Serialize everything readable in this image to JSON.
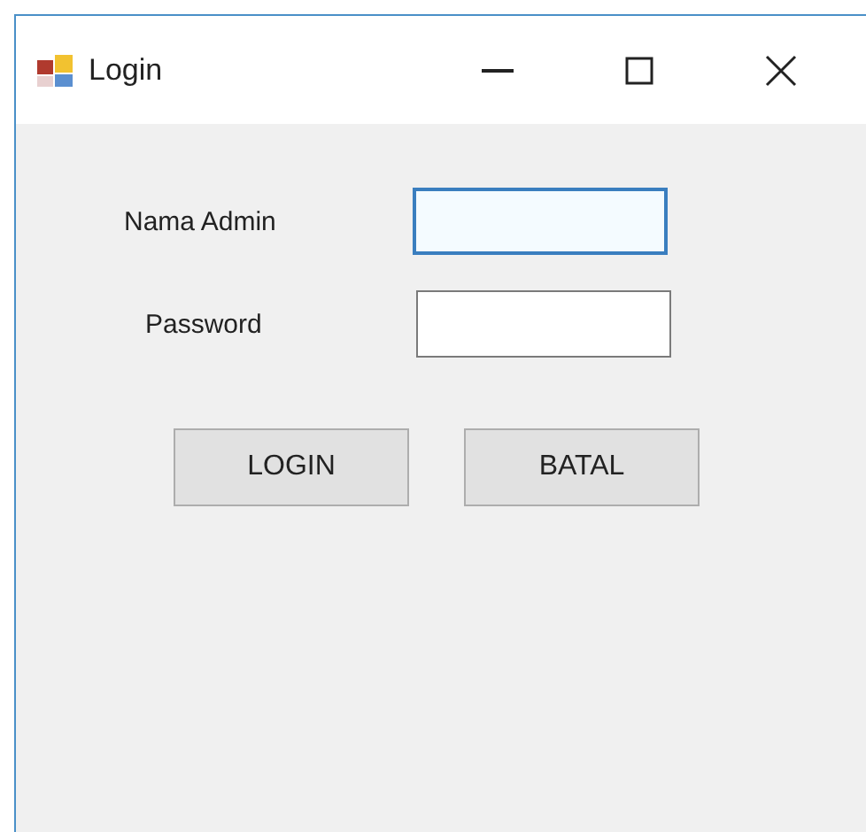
{
  "window": {
    "title": "Login"
  },
  "fields": [
    {
      "label": "Nama Admin",
      "focused": true
    },
    {
      "label": "Password",
      "focused": false
    }
  ],
  "buttons": [
    "LOGIN",
    "BATAL"
  ]
}
